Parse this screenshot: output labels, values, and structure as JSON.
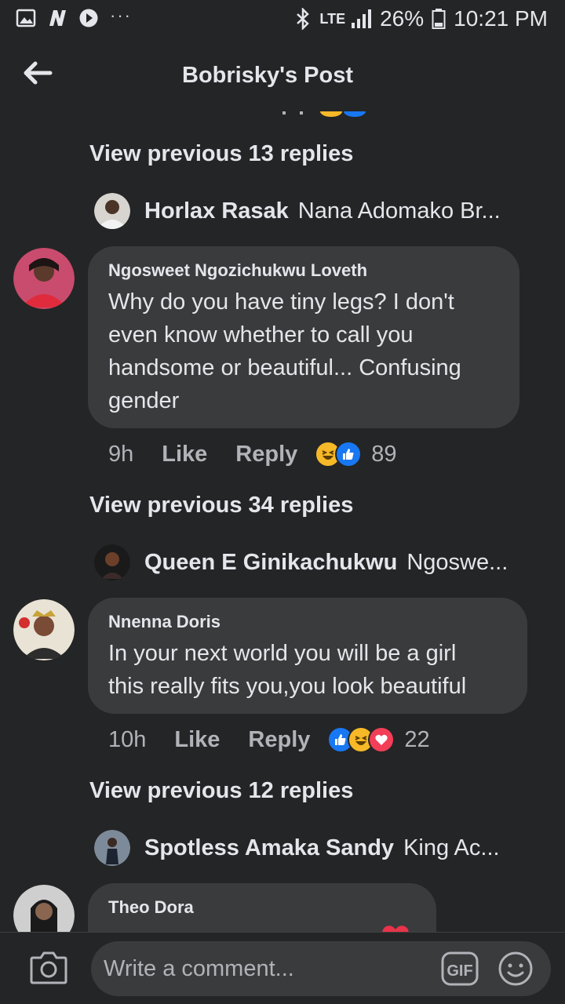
{
  "status_bar": {
    "icons": [
      "image-icon",
      "n-icon",
      "messenger-icon",
      "more-dots-icon"
    ],
    "dots": "···",
    "network": "LTE",
    "battery": "26%",
    "time": "10:21 PM"
  },
  "header": {
    "title": "Bobrisky's Post"
  },
  "feed": {
    "threads": [
      {
        "view_previous": "View previous 13 replies",
        "reply_preview": {
          "name": "Horlax Rasak",
          "text": "Nana Adomako Br..."
        },
        "comment": {
          "author": "Ngosweet Ngozichukwu Loveth",
          "lines": [
            "Why do you have tiny legs? I don't",
            "even know whether to call you",
            "handsome or beautiful... Confusing",
            "gender"
          ],
          "time": "9h",
          "like": "Like",
          "reply": "Reply",
          "reactions": [
            "haha",
            "like"
          ],
          "reaction_count": "89"
        }
      },
      {
        "view_previous": "View previous 34 replies",
        "reply_preview": {
          "name": "Queen E Ginikachukwu",
          "text": "Ngoswe..."
        },
        "comment": {
          "author": "Nnenna Doris",
          "lines": [
            "In your next world you will be a girl",
            "this really fits you,you look beautiful"
          ],
          "time": "10h",
          "like": "Like",
          "reply": "Reply",
          "reactions": [
            "like",
            "haha",
            "love"
          ],
          "reaction_count": "22"
        }
      },
      {
        "view_previous": "View previous 12 replies",
        "reply_preview": {
          "name": "Spotless Amaka Sandy",
          "text": "King Ac..."
        },
        "comment": {
          "author": "Theo Dora",
          "lines": [],
          "time": "",
          "like": "",
          "reply": "",
          "reactions": [
            "love"
          ],
          "reaction_count": ""
        }
      }
    ]
  },
  "composer": {
    "placeholder": "Write a comment...",
    "gif_label": "GIF"
  },
  "colors": {
    "background": "#242526",
    "bubble": "#3a3b3c",
    "text_primary": "#e4e6eb",
    "text_secondary": "#b0b3b8",
    "like_blue": "#1877f2",
    "haha_yellow": "#f7b928",
    "love_red": "#f33e58"
  }
}
